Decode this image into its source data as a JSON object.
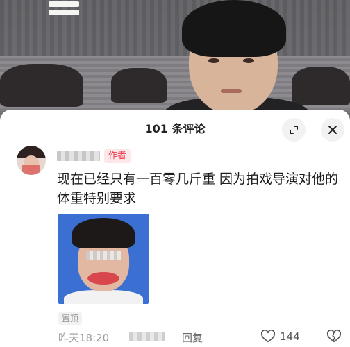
{
  "header": {
    "title": "101 条评论",
    "expand_icon": "expand-icon",
    "close_icon": "close-icon"
  },
  "comment": {
    "author_badge": "作者",
    "text": "现在已经只有一百零几斤重 因为拍戏导演对他的体重特别要求",
    "pinned_label": "置顶",
    "timestamp": "昨天18:20",
    "reply_label": "回复",
    "like_count": "144"
  },
  "colors": {
    "badge_text": "#ef3b4f",
    "badge_bg": "#fde7e9",
    "muted_text": "#9a9a9a"
  }
}
